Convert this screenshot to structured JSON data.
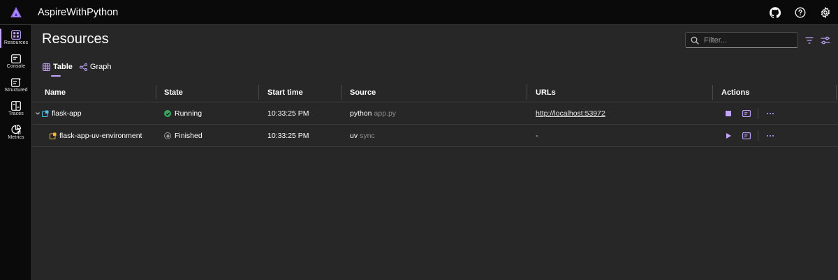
{
  "app": {
    "title": "AspireWithPython"
  },
  "colors": {
    "accent": "#c3a5ff",
    "running": "#3aa55d",
    "background": "#272727",
    "chrome": "#0a0a0a"
  },
  "topbar": {
    "icons": [
      "github-icon",
      "help-icon",
      "settings-icon"
    ]
  },
  "sidebar": {
    "items": [
      {
        "label": "Resources",
        "icon": "resources-grid-icon",
        "active": true
      },
      {
        "label": "Console",
        "icon": "console-icon"
      },
      {
        "label": "Structured",
        "icon": "structured-logs-icon"
      },
      {
        "label": "Traces",
        "icon": "traces-icon"
      },
      {
        "label": "Metrics",
        "icon": "metrics-icon"
      }
    ]
  },
  "page": {
    "title": "Resources"
  },
  "filter": {
    "placeholder": "Filter..."
  },
  "tabs": [
    {
      "label": "Table",
      "icon": "table-icon",
      "active": true
    },
    {
      "label": "Graph",
      "icon": "graph-icon"
    }
  ],
  "table": {
    "columns": [
      "Name",
      "State",
      "Start time",
      "Source",
      "URLs",
      "Actions"
    ],
    "rows": [
      {
        "name": "flask-app",
        "state": "Running",
        "start_time": "10:33:25 PM",
        "source_cmd": "python",
        "source_arg": "app.py",
        "url": "http://localhost:53972",
        "primary_action": "stop-icon"
      },
      {
        "name": "flask-app-uv-environment",
        "state": "Finished",
        "start_time": "10:33:25 PM",
        "source_cmd": "uv",
        "source_arg": "sync",
        "url": "-",
        "primary_action": "play-icon"
      }
    ]
  }
}
